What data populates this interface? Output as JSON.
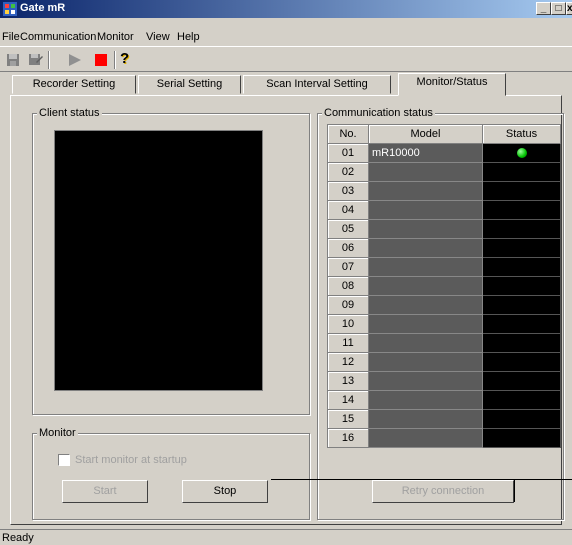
{
  "window": {
    "title": "Gate mR",
    "minimize": "_",
    "maximize": "□",
    "close": "x"
  },
  "menu": [
    "File",
    "Communication",
    "Monitor",
    "View",
    "Help"
  ],
  "toolbar": {
    "help_glyph": "?"
  },
  "tabs": [
    {
      "label": "Recorder Setting",
      "active": false
    },
    {
      "label": "Serial Setting",
      "active": false
    },
    {
      "label": "Scan Interval Setting",
      "active": false
    },
    {
      "label": "Monitor/Status",
      "active": true
    }
  ],
  "client_status": {
    "title": "Client status"
  },
  "monitor": {
    "title": "Monitor",
    "checkbox_label": "Start monitor at startup",
    "checkbox_checked": false,
    "start_label": "Start",
    "stop_label": "Stop"
  },
  "communication": {
    "title": "Communication status",
    "headers": [
      "No.",
      "Model",
      "Status"
    ],
    "rows": [
      {
        "no": "01",
        "model": "mR10000",
        "led": "green"
      },
      {
        "no": "02",
        "model": ""
      },
      {
        "no": "03",
        "model": ""
      },
      {
        "no": "04",
        "model": ""
      },
      {
        "no": "05",
        "model": ""
      },
      {
        "no": "06",
        "model": ""
      },
      {
        "no": "07",
        "model": ""
      },
      {
        "no": "08",
        "model": ""
      },
      {
        "no": "09",
        "model": ""
      },
      {
        "no": "10",
        "model": ""
      },
      {
        "no": "11",
        "model": ""
      },
      {
        "no": "12",
        "model": ""
      },
      {
        "no": "13",
        "model": ""
      },
      {
        "no": "14",
        "model": ""
      },
      {
        "no": "15",
        "model": ""
      },
      {
        "no": "16",
        "model": ""
      }
    ],
    "retry_label": "Retry connection"
  },
  "statusbar": {
    "text": "Ready"
  },
  "colors": {
    "title_start": "#0a246a",
    "title_end": "#a6caf0",
    "led_on": "#00c000",
    "model_cell": "#5b5b5b"
  }
}
